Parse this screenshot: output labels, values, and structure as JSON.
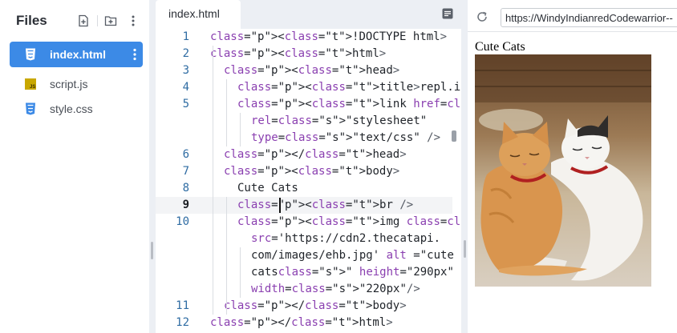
{
  "files": {
    "title": "Files",
    "items": [
      {
        "name": "index.html",
        "icon": "html-file-icon"
      },
      {
        "name": "script.js",
        "icon": "js-file-icon"
      },
      {
        "name": "style.css",
        "icon": "css-file-icon"
      }
    ]
  },
  "editor": {
    "tab_label": "index.html",
    "lines": [
      {
        "n": "1",
        "text": "<!DOCTYPE html>"
      },
      {
        "n": "2",
        "text": "<html>"
      },
      {
        "n": "3",
        "text": "<head>"
      },
      {
        "n": "4",
        "text": "<title>repl.it</title>"
      },
      {
        "n": "5",
        "text": "<link href=\"style.css\""
      },
      {
        "n": "",
        "text": "rel=\"stylesheet\""
      },
      {
        "n": "",
        "text": "type=\"text/css\" />"
      },
      {
        "n": "6",
        "text": "</head>"
      },
      {
        "n": "7",
        "text": "<body>"
      },
      {
        "n": "8",
        "text": "Cute Cats"
      },
      {
        "n": "9",
        "text": "<br />"
      },
      {
        "n": "10",
        "text": "<img class=\"boxModel\""
      },
      {
        "n": "",
        "text": "src='https://cdn2.thecatapi."
      },
      {
        "n": "",
        "text": "com/images/ehb.jpg' alt =\"cute"
      },
      {
        "n": "",
        "text": "cats\" height=\"290px\""
      },
      {
        "n": "",
        "text": "width=\"220px\"/>"
      },
      {
        "n": "11",
        "text": "</body>"
      },
      {
        "n": "12",
        "text": "</html>"
      }
    ],
    "active_line": "9"
  },
  "preview": {
    "url": "https://WindyIndianredCodewarrior--",
    "heading": "Cute Cats",
    "image_alt": "cute cats"
  },
  "colors": {
    "accent": "#3c8ae6",
    "html_icon": "#3c8ae6",
    "js_icon": "#c9a800",
    "css_icon": "#3c8ae6"
  }
}
